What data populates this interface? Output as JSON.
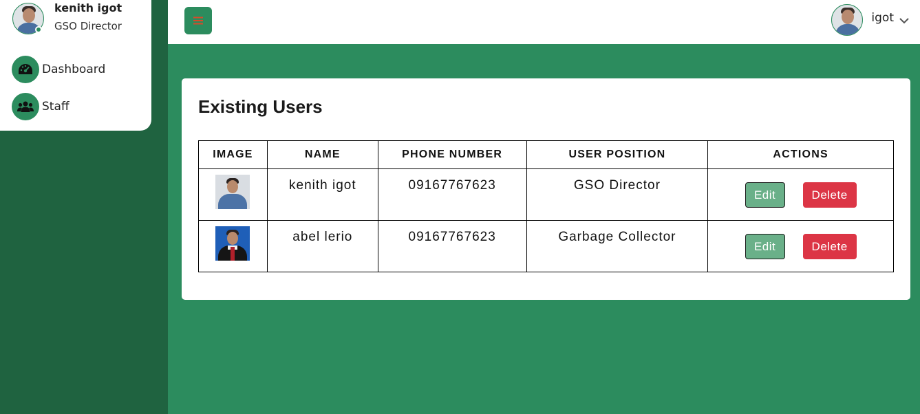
{
  "sidebar": {
    "profile": {
      "name": "kenith igot",
      "role": "GSO Director"
    },
    "items": [
      {
        "label": "Dashboard",
        "icon": "speedometer-icon"
      },
      {
        "label": "Staff",
        "icon": "users-icon"
      }
    ]
  },
  "header": {
    "menu_icon": "hamburger-icon",
    "user_name": "igot"
  },
  "main": {
    "title": "Existing Users",
    "table": {
      "columns": [
        "IMAGE",
        "NAME",
        "PHONE NUMBER",
        "USER POSITION",
        "ACTIONS"
      ],
      "rows": [
        {
          "image": "user-photo",
          "name": "kenith igot",
          "phone": "09167767623",
          "position": "GSO Director",
          "edit_label": "Edit",
          "delete_label": "Delete"
        },
        {
          "image": "user-photo",
          "name": "abel lerio",
          "phone": "09167767623",
          "position": "Garbage Collector",
          "edit_label": "Edit",
          "delete_label": "Delete"
        }
      ]
    }
  },
  "colors": {
    "primary_green": "#2c8c5e",
    "sidebar_dark": "#1f6340",
    "edit_green": "#6ab089",
    "delete_red": "#dc3545",
    "menu_icon": "#d84a2a"
  }
}
